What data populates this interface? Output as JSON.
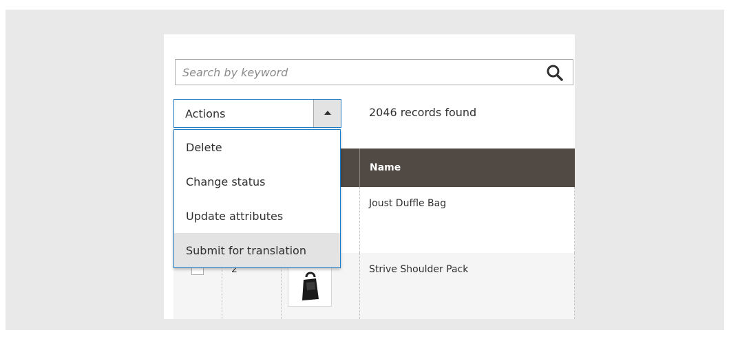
{
  "search": {
    "placeholder": "Search by keyword",
    "value": ""
  },
  "actions": {
    "label": "Actions",
    "toggle_icon": "triangle-up-icon",
    "menu": [
      {
        "label": "Delete"
      },
      {
        "label": "Change status"
      },
      {
        "label": "Update attributes"
      },
      {
        "label": "Submit for translation",
        "highlighted": true
      }
    ]
  },
  "records_found": "2046 records found",
  "grid": {
    "columns": [
      {
        "label": "Name"
      }
    ],
    "rows": [
      {
        "id": "",
        "name": "Joust Duffle Bag"
      },
      {
        "id": "2",
        "name": "Strive Shoulder Pack",
        "thumbnail": "shoulder-bag-image"
      }
    ]
  },
  "colors": {
    "accent": "#1979c3",
    "header_bg": "#514943",
    "highlight": "#e3e3e3",
    "backdrop": "#e8e9e8"
  }
}
